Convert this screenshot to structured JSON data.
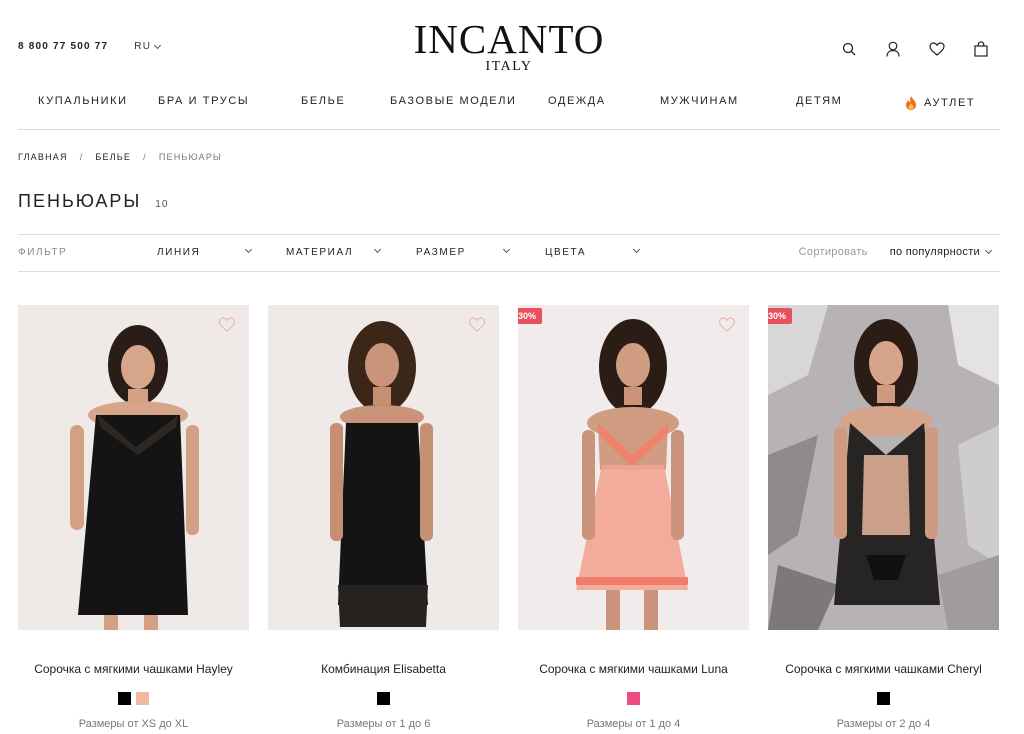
{
  "header": {
    "phone": "8 800 77 500 77",
    "lang": "RU",
    "logo_main": "INCANTO",
    "logo_sub": "ITALY",
    "icons": [
      "search-icon",
      "user-icon",
      "heart-icon",
      "bag-icon"
    ]
  },
  "nav": {
    "items": [
      {
        "label": "КУПАЛЬНИКИ"
      },
      {
        "label": "БРА И ТРУСЫ"
      },
      {
        "label": "БЕЛЬЕ"
      },
      {
        "label": "БАЗОВЫЕ МОДЕЛИ"
      },
      {
        "label": "ОДЕЖДА"
      },
      {
        "label": "МУЖЧИНАМ"
      },
      {
        "label": "ДЕТЯМ"
      },
      {
        "label": "АУТЛЕТ",
        "icon": "fire-icon"
      }
    ]
  },
  "breadcrumb": {
    "home": "ГЛАВНАЯ",
    "section": "БЕЛЬЕ",
    "current": "ПЕНЬЮАРЫ",
    "sep": "/"
  },
  "page": {
    "title": "ПЕНЬЮАРЫ",
    "count": "10"
  },
  "filters": {
    "label": "ФИЛЬТР",
    "dropdowns": [
      "ЛИНИЯ",
      "МАТЕРИАЛ",
      "РАЗМЕР",
      "ЦВЕТА"
    ],
    "sort_label": "Сортировать",
    "sort_value": "по популярности"
  },
  "products": [
    {
      "name": "Сорочка с мягкими чашками Hayley",
      "sizes": "Размеры от XS до XL",
      "badge": "",
      "bg": "#efe9e7",
      "swatches": [
        "#000000",
        "#f2b7a0"
      ]
    },
    {
      "name": "Комбинация Elisabetta",
      "sizes": "Размеры от 1 до 6",
      "badge": "",
      "bg": "#efe9e7",
      "swatches": [
        "#000000"
      ]
    },
    {
      "name": "Сорочка с мягкими чашками Luna",
      "sizes": "Размеры от 1 до 4",
      "badge": "30%",
      "bg": "#f1eceb",
      "swatches": [
        "#ee4d84"
      ]
    },
    {
      "name": "Сорочка с мягкими чашками Cheryl",
      "sizes": "Размеры от 2 до 4",
      "badge": "30%",
      "bg": "#b7b3b5",
      "swatches": [
        "#000000"
      ]
    }
  ],
  "colors": {
    "badge": "#e8505b",
    "fire": "#f36b21"
  }
}
